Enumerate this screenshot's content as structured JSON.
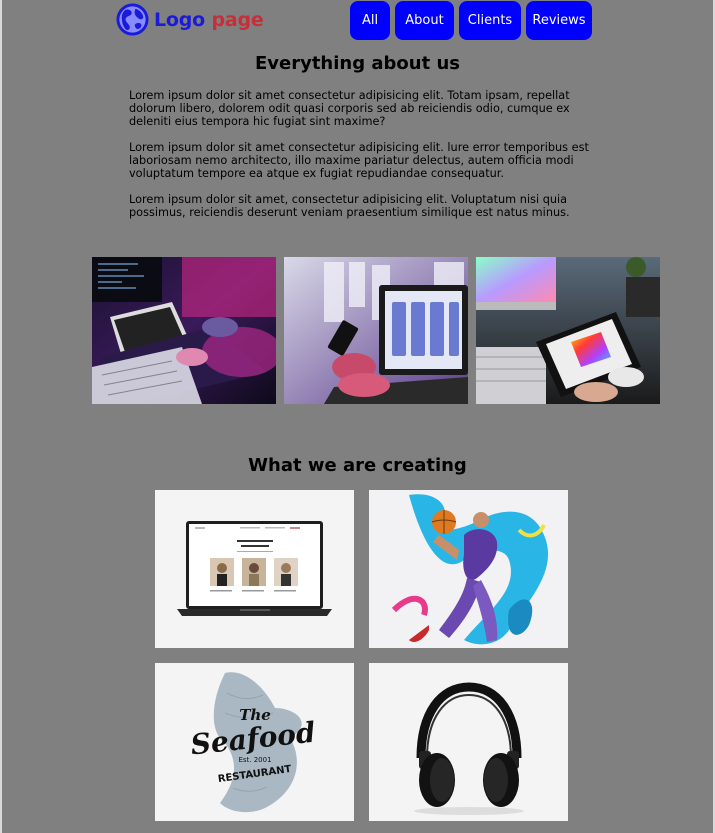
{
  "header": {
    "logo_word1": "Logo",
    "logo_word2": "page",
    "logo_icon": "globe-icon",
    "nav": [
      "All",
      "About",
      "Clients",
      "Reviews"
    ],
    "button_color": "#0000ff"
  },
  "about": {
    "title": "Everything about us",
    "paragraphs": [
      "Lorem ipsum dolor sit amet consectetur adipisicing elit. Totam ipsam, repellat dolorum libero, dolorem odit quasi corporis sed ab reiciendis odio, cumque ex deleniti eius tempora hic fugiat sint maxime?",
      "Lorem ipsum dolor sit amet consectetur adipisicing elit. lure error temporibus est laboriosam nemo architecto, illo maxime pariatur delectus, autem officia modi voluptatum tempore ea atque ex fugiat repudiandae consequatur.",
      "Lorem ipsum dolor sit amet, consectetur adipisicing elit. Voluptatum nisi quia possimus, reiciendis deserunt veniam praesentium similique est natus minus."
    ]
  },
  "creating": {
    "title": "What we are creating",
    "seafood_logo": [
      "The",
      "Seafood",
      "Est. 2001",
      "RESTAURANT"
    ]
  },
  "colors": {
    "background": "#808080",
    "logo_blue": "#1a1adb",
    "logo_red": "#c62f3a"
  }
}
